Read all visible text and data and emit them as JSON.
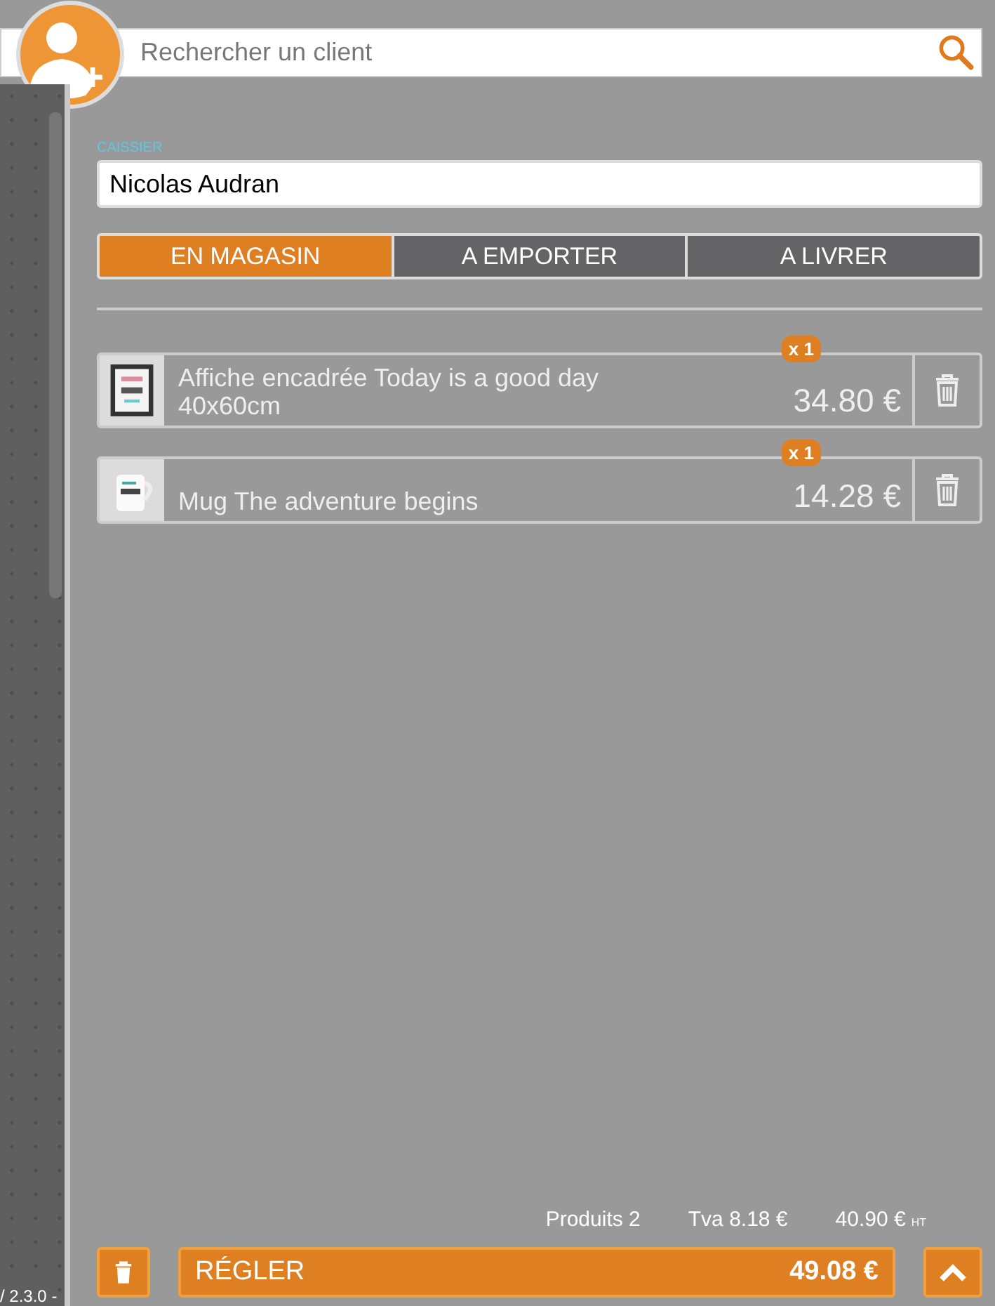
{
  "search": {
    "placeholder": "Rechercher un client"
  },
  "cashier": {
    "label": "CAISSIER",
    "value": "Nicolas Audran"
  },
  "tabs": [
    {
      "label": "EN MAGASIN",
      "selected": true
    },
    {
      "label": "A EMPORTER",
      "selected": false
    },
    {
      "label": "A LIVRER",
      "selected": false
    }
  ],
  "items": [
    {
      "name": "Affiche encadrée Today is a good day 40x60cm",
      "price": "34.80 €",
      "quantity": "x 1"
    },
    {
      "name": "Mug The adventure begins",
      "price": "14.28 €",
      "quantity": "x 1"
    }
  ],
  "summary": {
    "products": "Produits 2",
    "tax": "Tva 8.18 €",
    "subtotal": "40.90 €",
    "subtotal_unit": "HT"
  },
  "pay_button": {
    "label": "RÉGLER",
    "total": "49.08 €"
  },
  "version": "/ 2.3.0 -"
}
